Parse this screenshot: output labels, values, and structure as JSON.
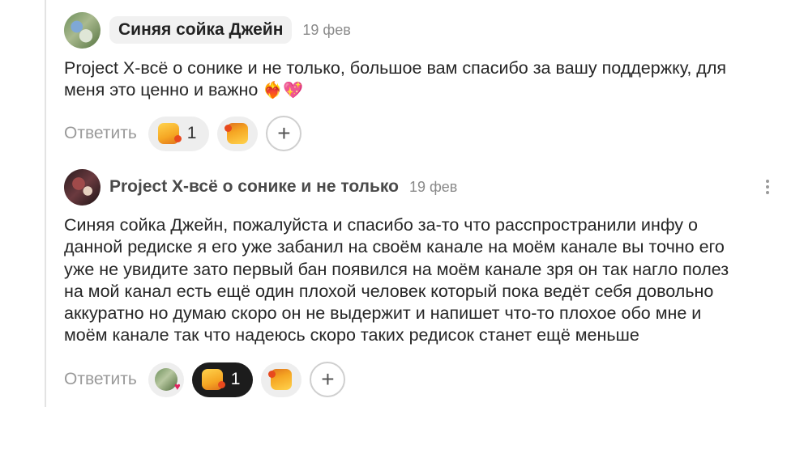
{
  "comments": [
    {
      "author": "Синяя сойка Джейн",
      "date": "19 фев",
      "text": "Project X-всё о сонике и не только, большое вам спасибо за вашу поддержку, для меня это ценно и важно",
      "emojis": "❤️‍🔥💖",
      "reply_label": "Ответить",
      "like_count": "1",
      "plus_label": "+"
    },
    {
      "author": "Project X-всё о сонике и не только",
      "date": "19 фев",
      "text": "Синяя сойка Джейн, пожалуйста и спасибо за-то что расспространили инфу о\nданной редиске я его уже забанил на своём канале на моём канале вы точно его\nуже не увидите зато первый бан появился на моём канале зря он так нагло полез\nна мой канал есть ещё один плохой человек который пока ведёт себя довольно\nаккуратно но думаю скоро он не выдержит и напишет что-то плохое обо мне и\nмоём канале так что надеюсь скоро таких редисок станет ещё меньше",
      "reply_label": "Ответить",
      "like_count": "1",
      "plus_label": "+"
    }
  ],
  "colors": {
    "active_like_bg": "#1c1c1c",
    "pill_bg": "#eeeeee",
    "muted_text": "#9a9a9a"
  },
  "icons": [
    "thumbs-up-icon",
    "thumbs-down-icon",
    "plus-icon",
    "more-vertical-icon",
    "heart-icon"
  ]
}
